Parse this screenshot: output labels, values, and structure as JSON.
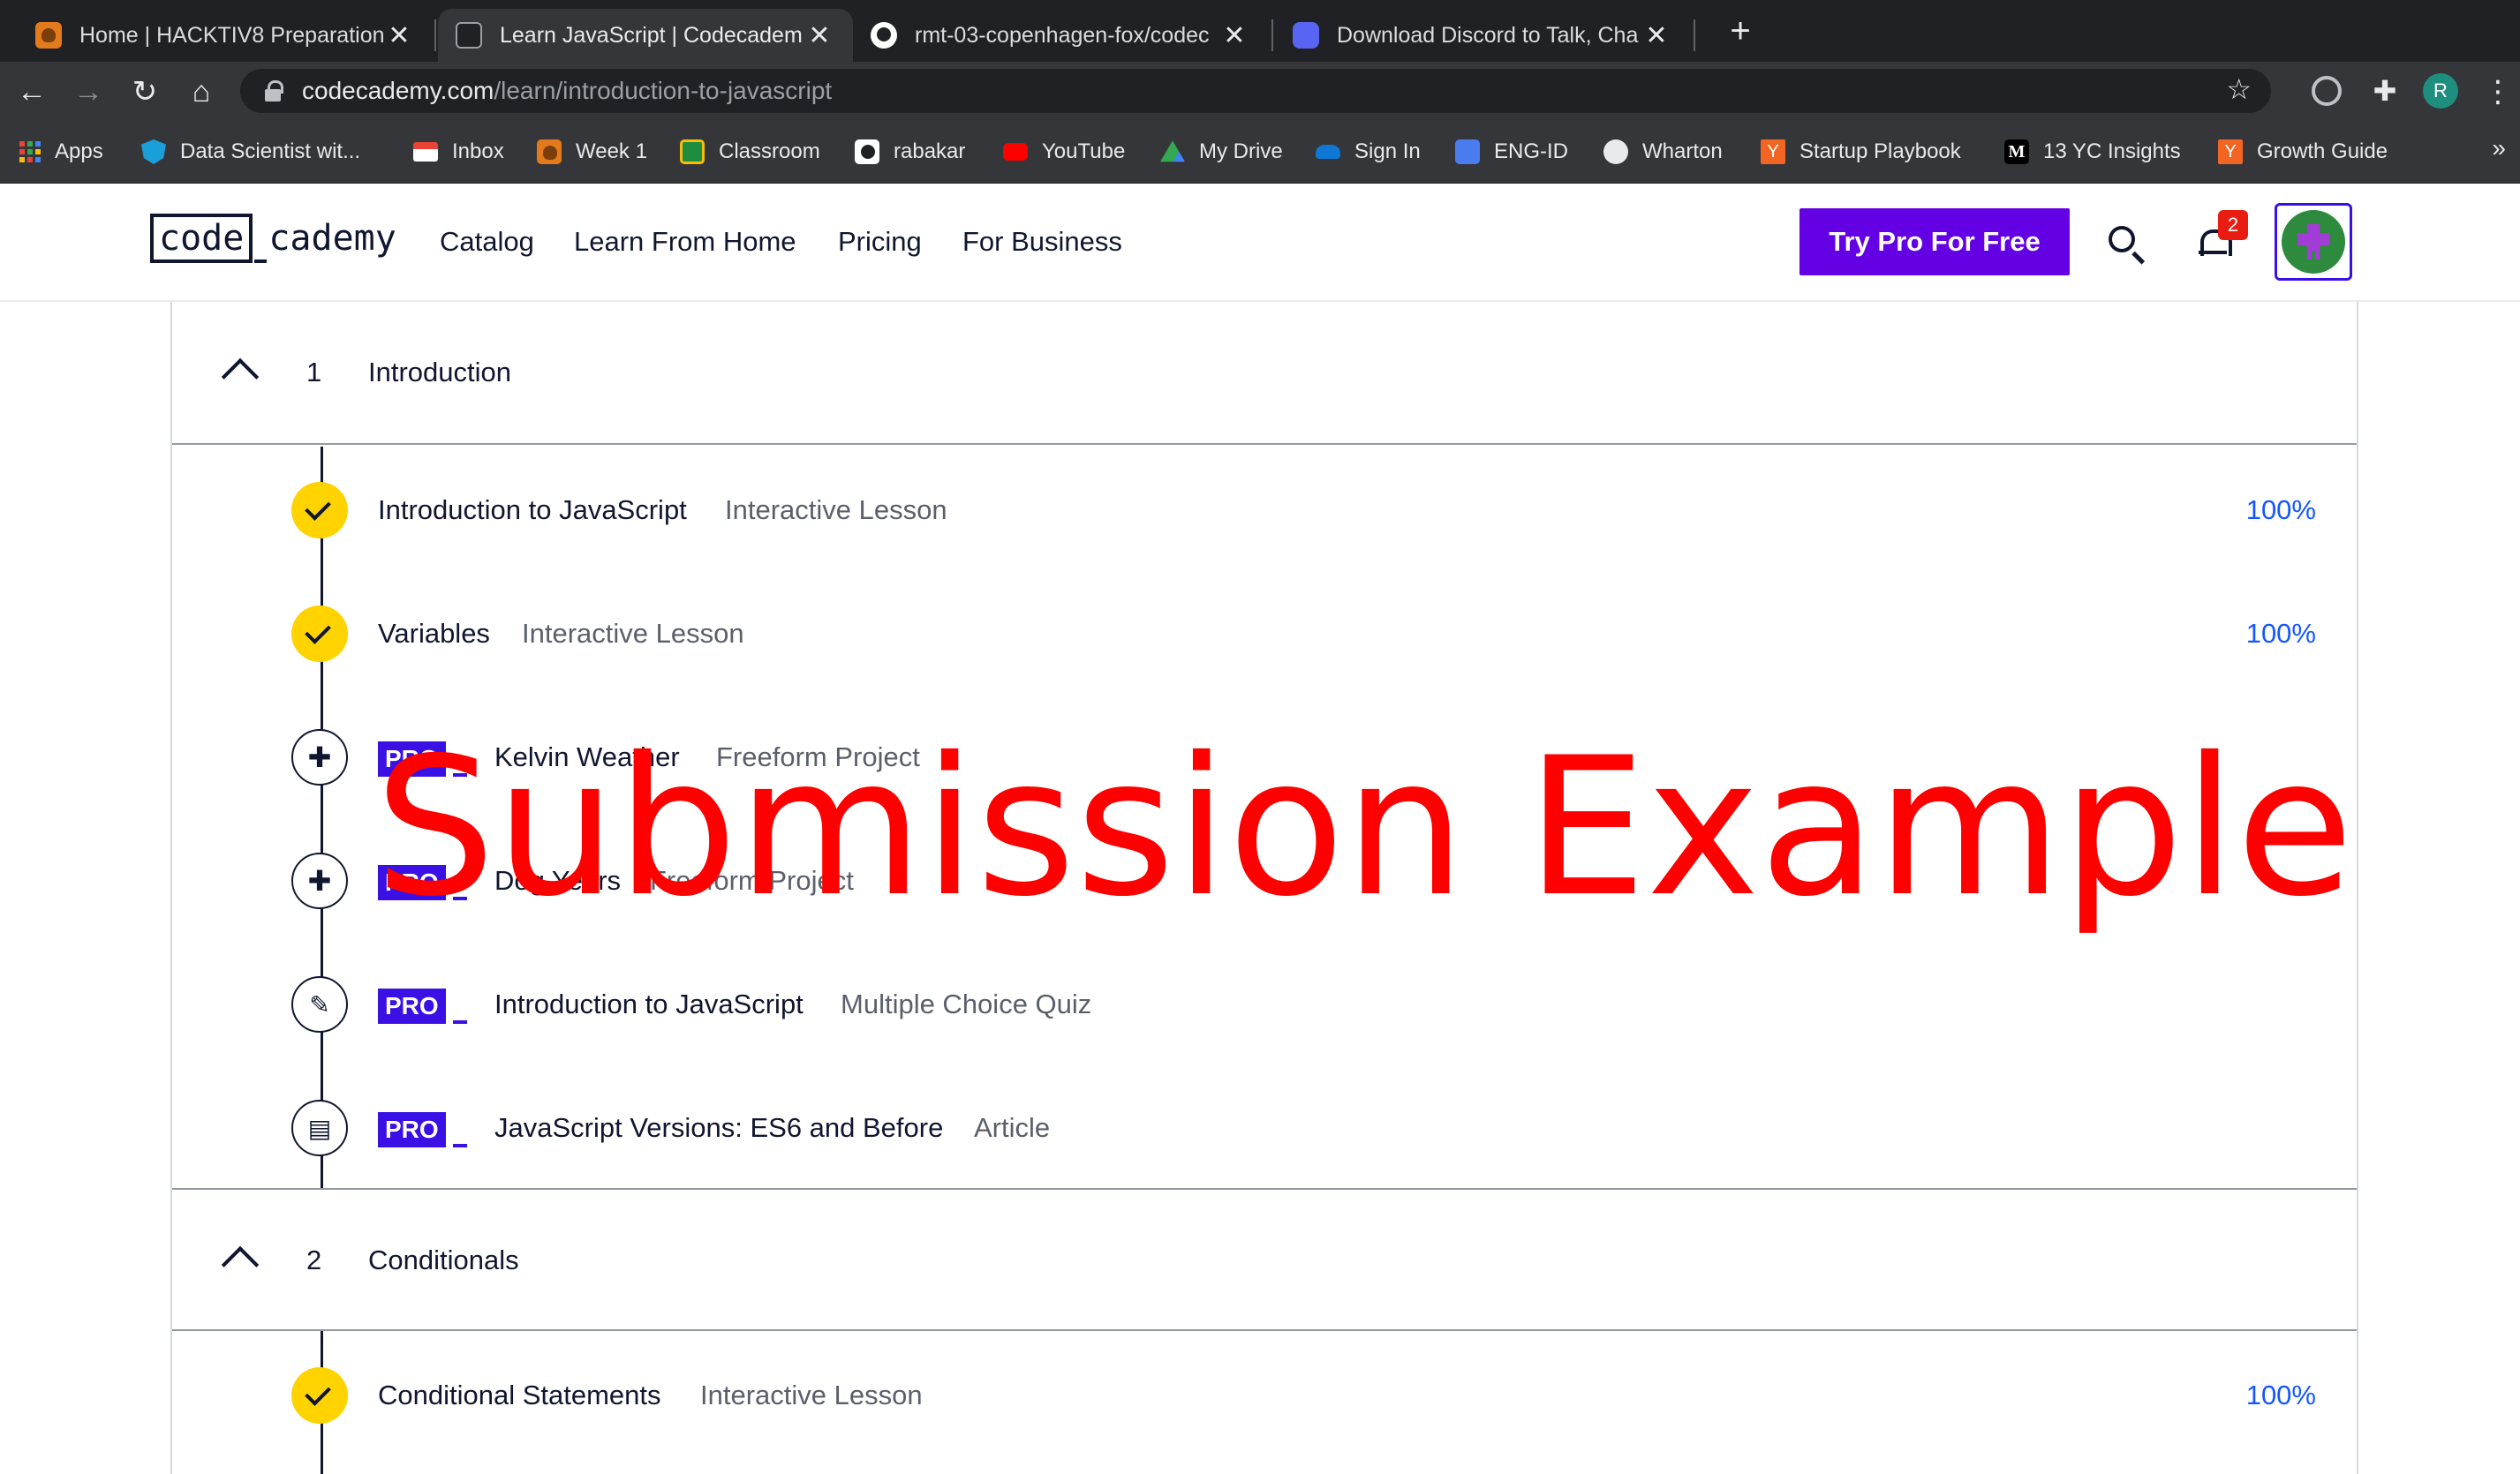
{
  "browser": {
    "tabs": [
      {
        "title": "Home | HACKTIV8 Preparation",
        "icon": "fox-icon",
        "active": false
      },
      {
        "title": "Learn JavaScript | Codecadem",
        "icon": "codecademy-icon",
        "active": true
      },
      {
        "title": "rmt-03-copenhagen-fox/codec",
        "icon": "github-icon",
        "active": false
      },
      {
        "title": "Download Discord to Talk, Cha",
        "icon": "discord-icon",
        "active": false
      }
    ],
    "close_glyph": "✕",
    "new_tab_glyph": "+",
    "url_host": "codecademy.com",
    "url_path": "/learn/introduction-to-javascript",
    "profile_initial": "R",
    "bookmarks": [
      {
        "label": "Apps",
        "icon": "apps-grid-icon",
        "color": "#ea4335"
      },
      {
        "label": "Data Scientist wit...",
        "icon": "shield-icon",
        "color": "#1a9fd9"
      },
      {
        "label": "Inbox",
        "icon": "gmail-icon",
        "color": "#ea4335"
      },
      {
        "label": "Week 1",
        "icon": "fox-icon",
        "color": "#e37a1c"
      },
      {
        "label": "Classroom",
        "icon": "classroom-icon",
        "color": "#1e8e3e"
      },
      {
        "label": "rabakar",
        "icon": "github-icon",
        "color": "#ffffff"
      },
      {
        "label": "YouTube",
        "icon": "youtube-icon",
        "color": "#ff0000"
      },
      {
        "label": "My Drive",
        "icon": "drive-icon",
        "color": "#fbbc04"
      },
      {
        "label": "Sign In",
        "icon": "onedrive-icon",
        "color": "#0f78d4"
      },
      {
        "label": "ENG-ID",
        "icon": "translate-icon",
        "color": "#4a7cf0"
      },
      {
        "label": "Wharton",
        "icon": "globe-icon",
        "color": "#e8eaed"
      },
      {
        "label": "Startup Playbook",
        "icon": "ycombinator-icon",
        "color": "#f26522"
      },
      {
        "label": "13 YC Insights",
        "icon": "medium-icon",
        "color": "#000000"
      },
      {
        "label": "Growth Guide",
        "icon": "ycombinator-icon",
        "color": "#f26522"
      }
    ],
    "more_glyph": "»"
  },
  "site": {
    "logo_left": "code",
    "logo_right": "cademy",
    "nav": [
      "Catalog",
      "Learn From Home",
      "Pricing",
      "For Business"
    ],
    "cta": "Try Pro For Free",
    "notification_count": "2",
    "accent": "#6400e4",
    "pro_color": "#3a10e5"
  },
  "syllabus": {
    "modules": [
      {
        "number": "1",
        "title": "Introduction",
        "lessons": [
          {
            "title": "Introduction to JavaScript",
            "type": "Interactive Lesson",
            "pro": false,
            "status": "done",
            "progress": "100%"
          },
          {
            "title": "Variables",
            "type": "Interactive Lesson",
            "pro": false,
            "status": "done",
            "progress": "100%"
          },
          {
            "title": "Kelvin Weather",
            "type": "Freeform Project",
            "pro": true,
            "status": "todo",
            "icon": "puzzle-icon",
            "progress": ""
          },
          {
            "title": "Dog Years",
            "type": "Freeform Project",
            "pro": true,
            "status": "todo",
            "icon": "puzzle-icon",
            "progress": ""
          },
          {
            "title": "Introduction to JavaScript",
            "type": "Multiple Choice Quiz",
            "pro": true,
            "status": "todo",
            "icon": "pencil-icon",
            "progress": ""
          },
          {
            "title": "JavaScript Versions: ES6 and Before",
            "type": "Article",
            "pro": true,
            "status": "todo",
            "icon": "article-icon",
            "progress": ""
          }
        ]
      },
      {
        "number": "2",
        "title": "Conditionals",
        "lessons": [
          {
            "title": "Conditional Statements",
            "type": "Interactive Lesson",
            "pro": false,
            "status": "done",
            "progress": "100%"
          }
        ]
      }
    ],
    "pro_label": "PRO"
  },
  "watermark": "Submission Example"
}
